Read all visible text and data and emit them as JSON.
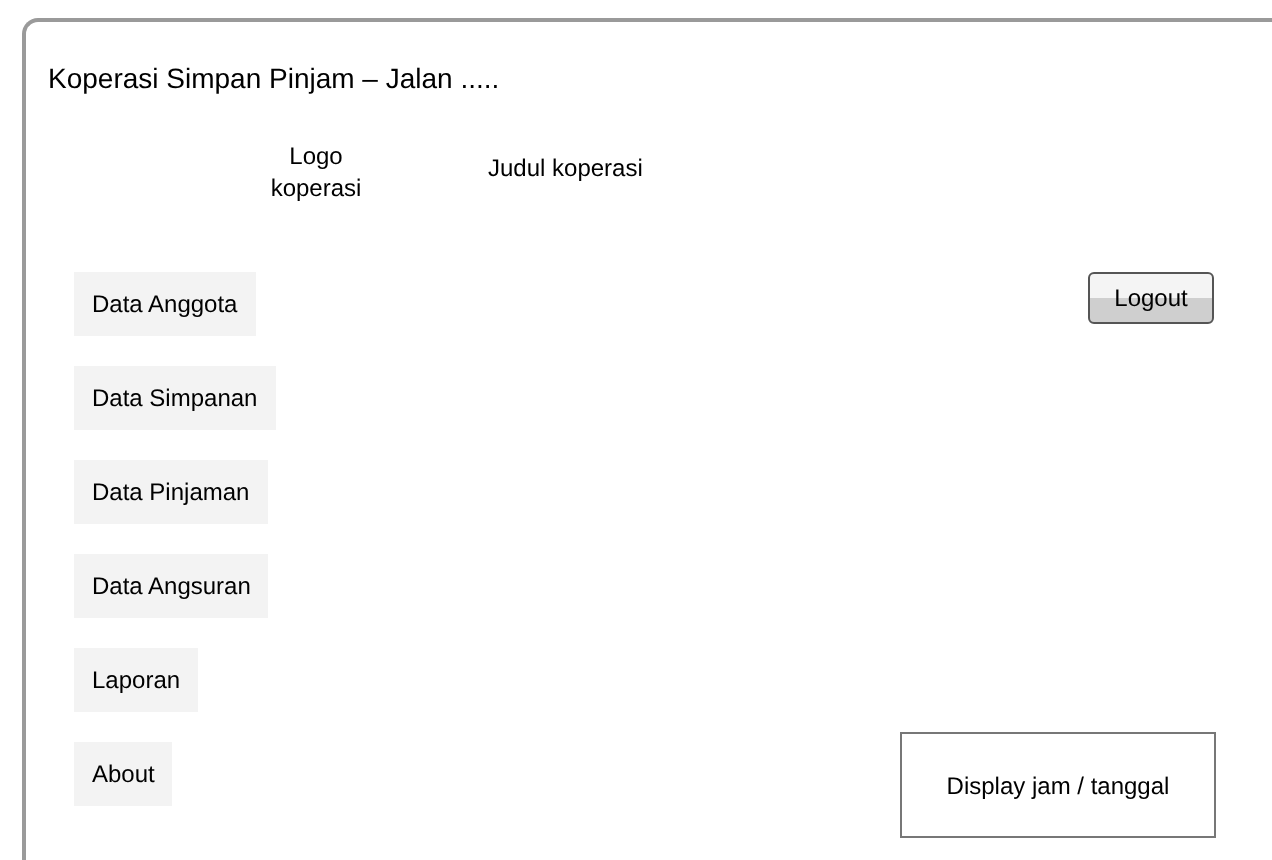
{
  "window": {
    "title": "Koperasi Simpan Pinjam – Jalan ....."
  },
  "header": {
    "logo": "Logo koperasi",
    "heading": "Judul koperasi"
  },
  "menu": [
    {
      "label": "Data Anggota"
    },
    {
      "label": "Data Simpanan"
    },
    {
      "label": "Data Pinjaman"
    },
    {
      "label": "Data Angsuran"
    },
    {
      "label": "Laporan"
    },
    {
      "label": "About"
    }
  ],
  "logout_button": "Logout",
  "clock_display": "Display jam / tanggal"
}
